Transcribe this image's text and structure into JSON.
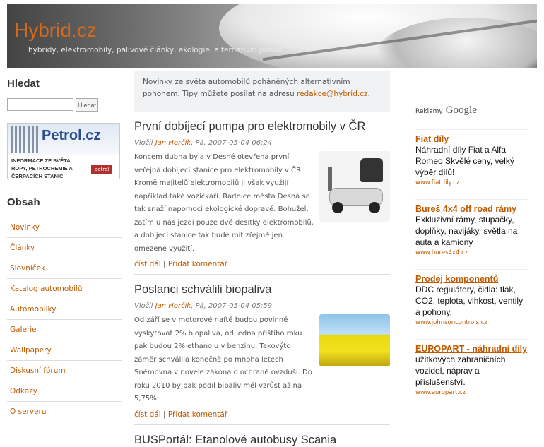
{
  "header": {
    "logo": "Hybrid.cz",
    "tagline": "hybridy, elektromobily, palivové články, ekologie, alternativní pohon"
  },
  "sidebar": {
    "search_title": "Hledat",
    "search_button": "Hledat",
    "search_value": "",
    "banner": {
      "brand": "Petrol.cz",
      "text": "INFORMACE ZE SVĚTA ROPY, PETROCHEMIE A ČERPACÍCH STANIC",
      "mini_logo": "petrol"
    },
    "menu_title": "Obsah",
    "menu": [
      "Novinky",
      "Články",
      "Slovníček",
      "Katalog automobilů",
      "Automobilky",
      "Galerie",
      "Wallpapery",
      "Diskusní fórum",
      "Odkazy",
      "O serveru"
    ]
  },
  "intro": {
    "text": "Novinky ze světa automobilů poháněných alternativním pohonem. Tipy můžete posílat na adresu ",
    "email": "redakce@hybrid.cz",
    "end": "."
  },
  "articles": [
    {
      "title": "První dobíjecí pumpa pro elektromobily v ČR",
      "meta_prefix": "Vložil",
      "author": "Jan Horčík",
      "date": ", Pá, 2007-05-04 06:24",
      "text": "Koncem dubna byla v Desné otevřena první veřejná dobíjecí stanice pro elektromobily v ČR. Kromě majitelů elektromobilů ji však využijí například také vozíčkáři. Radnice města Desná se tak snaží napomoci ekologické dopravě. Bohužel, zatím u nás jezdí pouze dvě desítky elektromobilů, a dobíjecí stanice tak bude mít zřejmě jen omezené využití.",
      "read_more": "číst dál",
      "sep": " | ",
      "comment": "Přidat komentář",
      "image": "mobility-scooter"
    },
    {
      "title": "Poslanci schválili biopaliva",
      "meta_prefix": "Vložil",
      "author": "Jan Horčík",
      "date": ", Pá, 2007-05-04 05:59",
      "text": "Od září se v motorové naftě budou povinně vyskytovat 2% biopaliva, od ledna příštího roku pak budou 2% ethanolu v benzinu. Takovýto záměr schválila konečně po mnoha letech Sněmovna v novele zákona o ochraně ovzduší. Do roku 2010 by pak podíl bipaliv měl vzrůst až na 5,75%.",
      "read_more": "číst dál",
      "sep": " | ",
      "comment": "Přidat komentář",
      "image": "rapeseed-field"
    },
    {
      "title": "BUSPortál: Etanolové autobusy Scania"
    }
  ],
  "ads": {
    "label": "Reklamy",
    "brand": "Google",
    "items": [
      {
        "title": "Fiat díly",
        "text": "Náhradní díly Fiat a Alfa Romeo Skvělé ceny, velký výběr dílů!",
        "url": "www.fiatdily.cz"
      },
      {
        "title": "Bureš 4x4 off road rámy",
        "text": "Exkluzivní rámy, stupačky, doplňky, navijáky, světla na auta a kamiony",
        "url": "www.bures4x4.cz"
      },
      {
        "title": "Prodej komponentů",
        "text": "DDC regulátory, čidla: tlak, CO2, teplota, vlhkost, ventily a pohony.",
        "url": "www.johnsoncontrols.cz"
      },
      {
        "title": "EUROPART - náhradní díly",
        "text": "užitkových zahraničních vozidel, náprav a příslušenství.",
        "url": "www.europart.cz"
      }
    ]
  }
}
